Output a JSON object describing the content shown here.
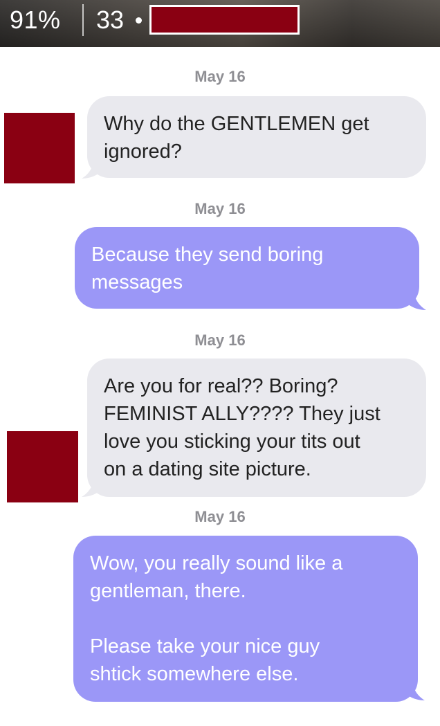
{
  "header": {
    "match_percent": "91%",
    "age": "33"
  },
  "colors": {
    "incoming_bubble": "#e9e9ee",
    "outgoing_bubble": "#9b97f7",
    "redaction": "#8a0012"
  },
  "messages": [
    {
      "date": "May 16",
      "direction": "incoming",
      "text": "Why do the GENTLEMEN get\nignored?"
    },
    {
      "date": "May 16",
      "direction": "outgoing",
      "text": "Because they send boring\nmessages"
    },
    {
      "date": "May 16",
      "direction": "incoming",
      "text": "Are you for real?? Boring?\nFEMINIST ALLY???? They just\nlove you sticking your tits out\non a dating site picture."
    },
    {
      "date": "May 16",
      "direction": "outgoing",
      "text": "Wow, you really sound like a\ngentleman, there.\n\nPlease take your nice guy\nshtick somewhere else."
    }
  ]
}
